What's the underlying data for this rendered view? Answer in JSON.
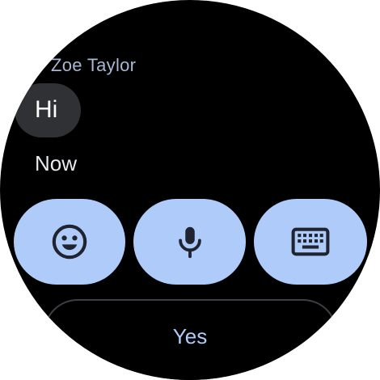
{
  "conversation": {
    "sender": "Zoe Taylor",
    "message": "Hi",
    "timestamp": "Now"
  },
  "actions": [
    {
      "name": "emoji",
      "icon": "emoji-icon"
    },
    {
      "name": "voice",
      "icon": "microphone-icon"
    },
    {
      "name": "keyboard",
      "icon": "keyboard-icon"
    }
  ],
  "quick_reply": {
    "label": "Yes"
  },
  "colors": {
    "background": "#000000",
    "accent": "#aecbfa",
    "sender_text": "#a9b7d2",
    "bubble": "#303134",
    "icon": "#1f2430"
  }
}
